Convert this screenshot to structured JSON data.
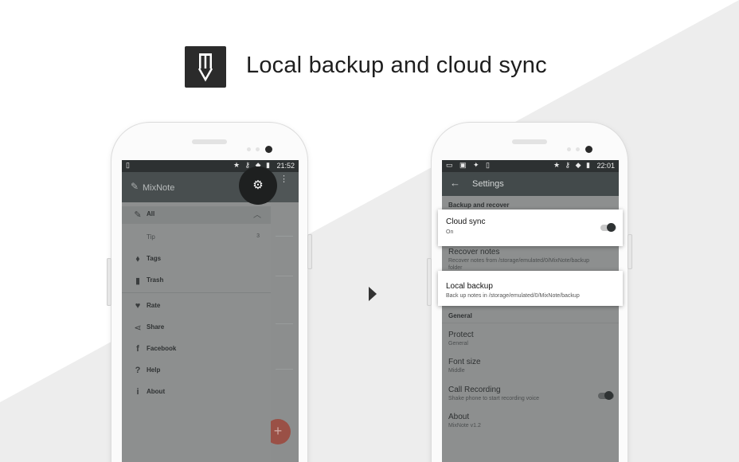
{
  "colors": {
    "accent": "#2b2b2b",
    "screen_overlay": "#8d8f8f",
    "fab": "#9a5046"
  },
  "headline": "Local backup and cloud sync",
  "left_phone": {
    "status_time": "21:52",
    "app_name": "MixNote",
    "nav": [
      {
        "icon": "tag-icon",
        "label": "All",
        "glyph": "✎"
      },
      {
        "icon": "",
        "label": "Tip",
        "count": "3"
      },
      {
        "icon": "tags-icon",
        "label": "Tags",
        "glyph": "⬧"
      },
      {
        "icon": "trash-icon",
        "label": "Trash",
        "glyph": "▮"
      },
      {
        "icon": "heart-icon",
        "label": "Rate",
        "glyph": "♥"
      },
      {
        "icon": "share-icon",
        "label": "Share",
        "glyph": "⋖"
      },
      {
        "icon": "facebook-icon",
        "label": "Facebook",
        "glyph": "f"
      },
      {
        "icon": "help-icon",
        "label": "Help",
        "glyph": "?"
      },
      {
        "icon": "info-icon",
        "label": "About",
        "glyph": "i"
      }
    ]
  },
  "right_phone": {
    "status_time": "22:01",
    "title": "Settings",
    "section_backup": "Backup and recover",
    "cloud_sync": {
      "title": "Cloud sync",
      "subtitle": "On"
    },
    "recover": {
      "title": "Recover notes",
      "subtitle": "Recover notes from /storage/emulated/0/MixNote/backup",
      "subtitle2": "folder"
    },
    "local_backup": {
      "title": "Local backup",
      "subtitle": "Back up notes in /storage/emulated/0/MixNote/backup"
    },
    "section_general": "General",
    "protect": {
      "title": "Protect",
      "subtitle": "General"
    },
    "font_size": {
      "title": "Font size",
      "subtitle": "Middle"
    },
    "call_recording": {
      "title": "Call Recording",
      "subtitle": "Shake phone to start recording voice"
    },
    "about": {
      "title": "About",
      "subtitle": "MixNote v1.2"
    }
  }
}
